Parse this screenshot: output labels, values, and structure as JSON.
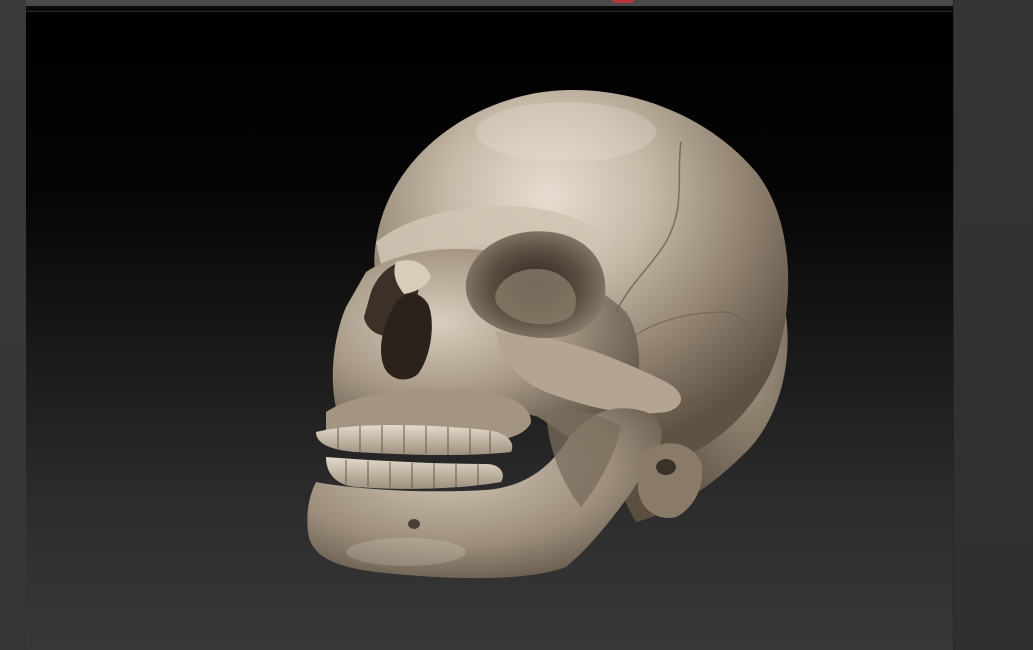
{
  "window": {
    "title": ""
  },
  "viewport": {
    "subject": "skull-model",
    "colors": {
      "bone": "#b9ad9c",
      "bone_highlight": "#e2d8c9",
      "bone_shadow": "#5b5043",
      "background_top": "#000000",
      "background_bottom": "#383838",
      "indicator": "#b8383a"
    }
  }
}
